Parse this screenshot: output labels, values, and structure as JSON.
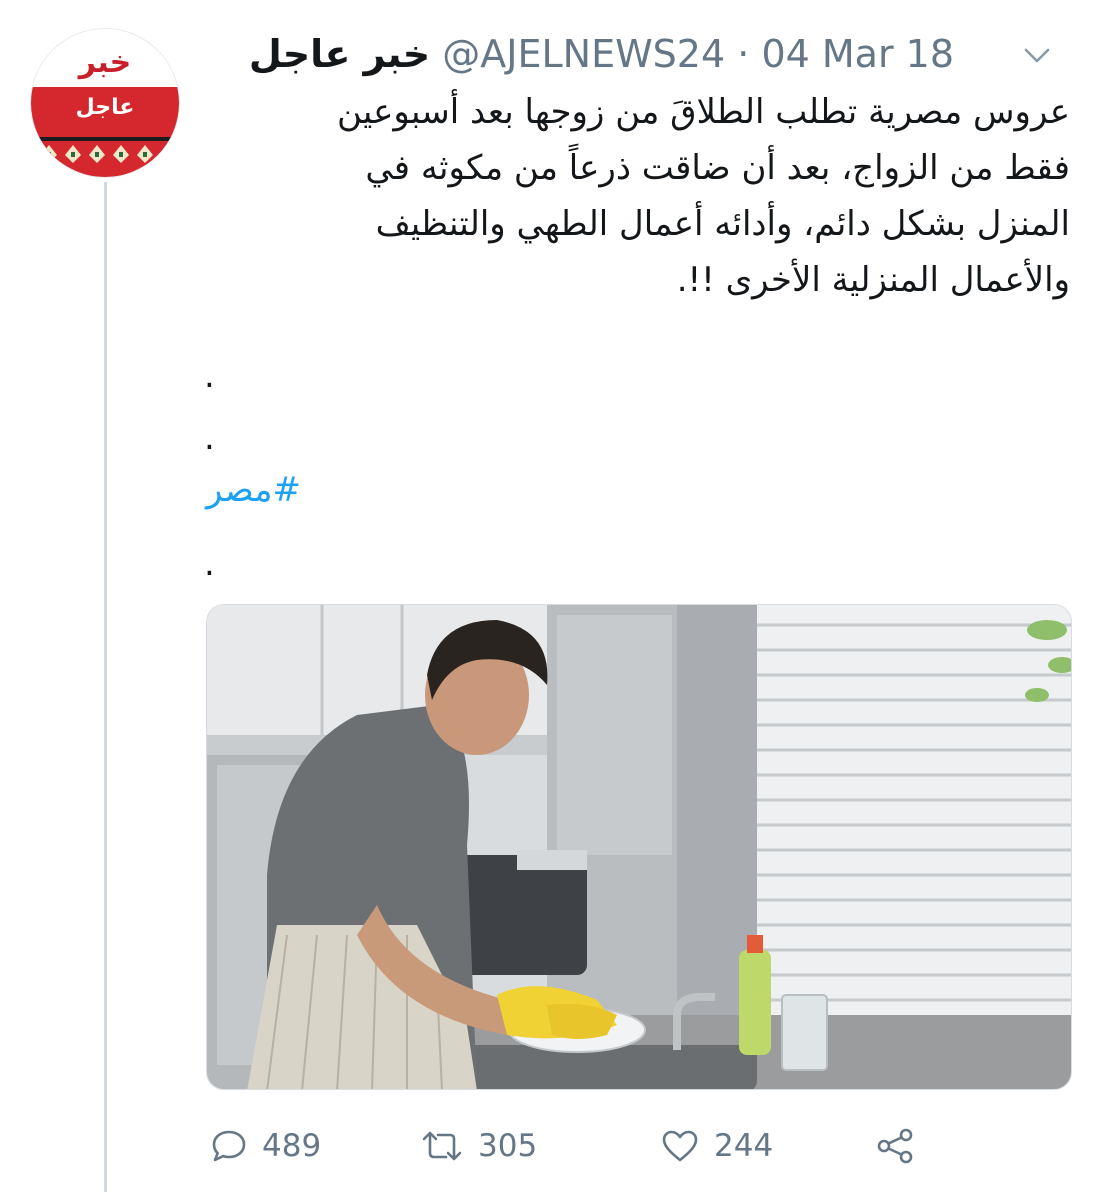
{
  "account": {
    "avatar_text_top": "خبر",
    "avatar_text_bottom": "عاجل",
    "display_name": "خبر عاجل",
    "handle": "@AJELNEWS24",
    "separator": "·",
    "date": "04 Mar 18"
  },
  "tweet": {
    "lines": [
      "عروس مصرية تطلب الطلاقَ من زوجها بعد أسبوعين",
      "فقط من الزواج، بعد أن ضاقت ذرعاً من مكوثه في",
      "المنزل بشكل دائم، وأدائه أعمال الطهي والتنظيف",
      "والأعمال المنزلية الأخرى !!."
    ],
    "dot_1": ".",
    "dot_2": ".",
    "hashtag": "#مصر",
    "dot_3": "."
  },
  "media": {
    "description_icon": "photo-man-washing-dishes"
  },
  "actions": {
    "reply_count": "489",
    "retweet_count": "305",
    "like_count": "244",
    "reply_icon": "comment-icon",
    "retweet_icon": "retweet-icon",
    "like_icon": "heart-icon",
    "share_icon": "share-icon"
  },
  "colors": {
    "link": "#1da1f2",
    "muted": "#657786",
    "avatar_red": "#d4282e"
  }
}
